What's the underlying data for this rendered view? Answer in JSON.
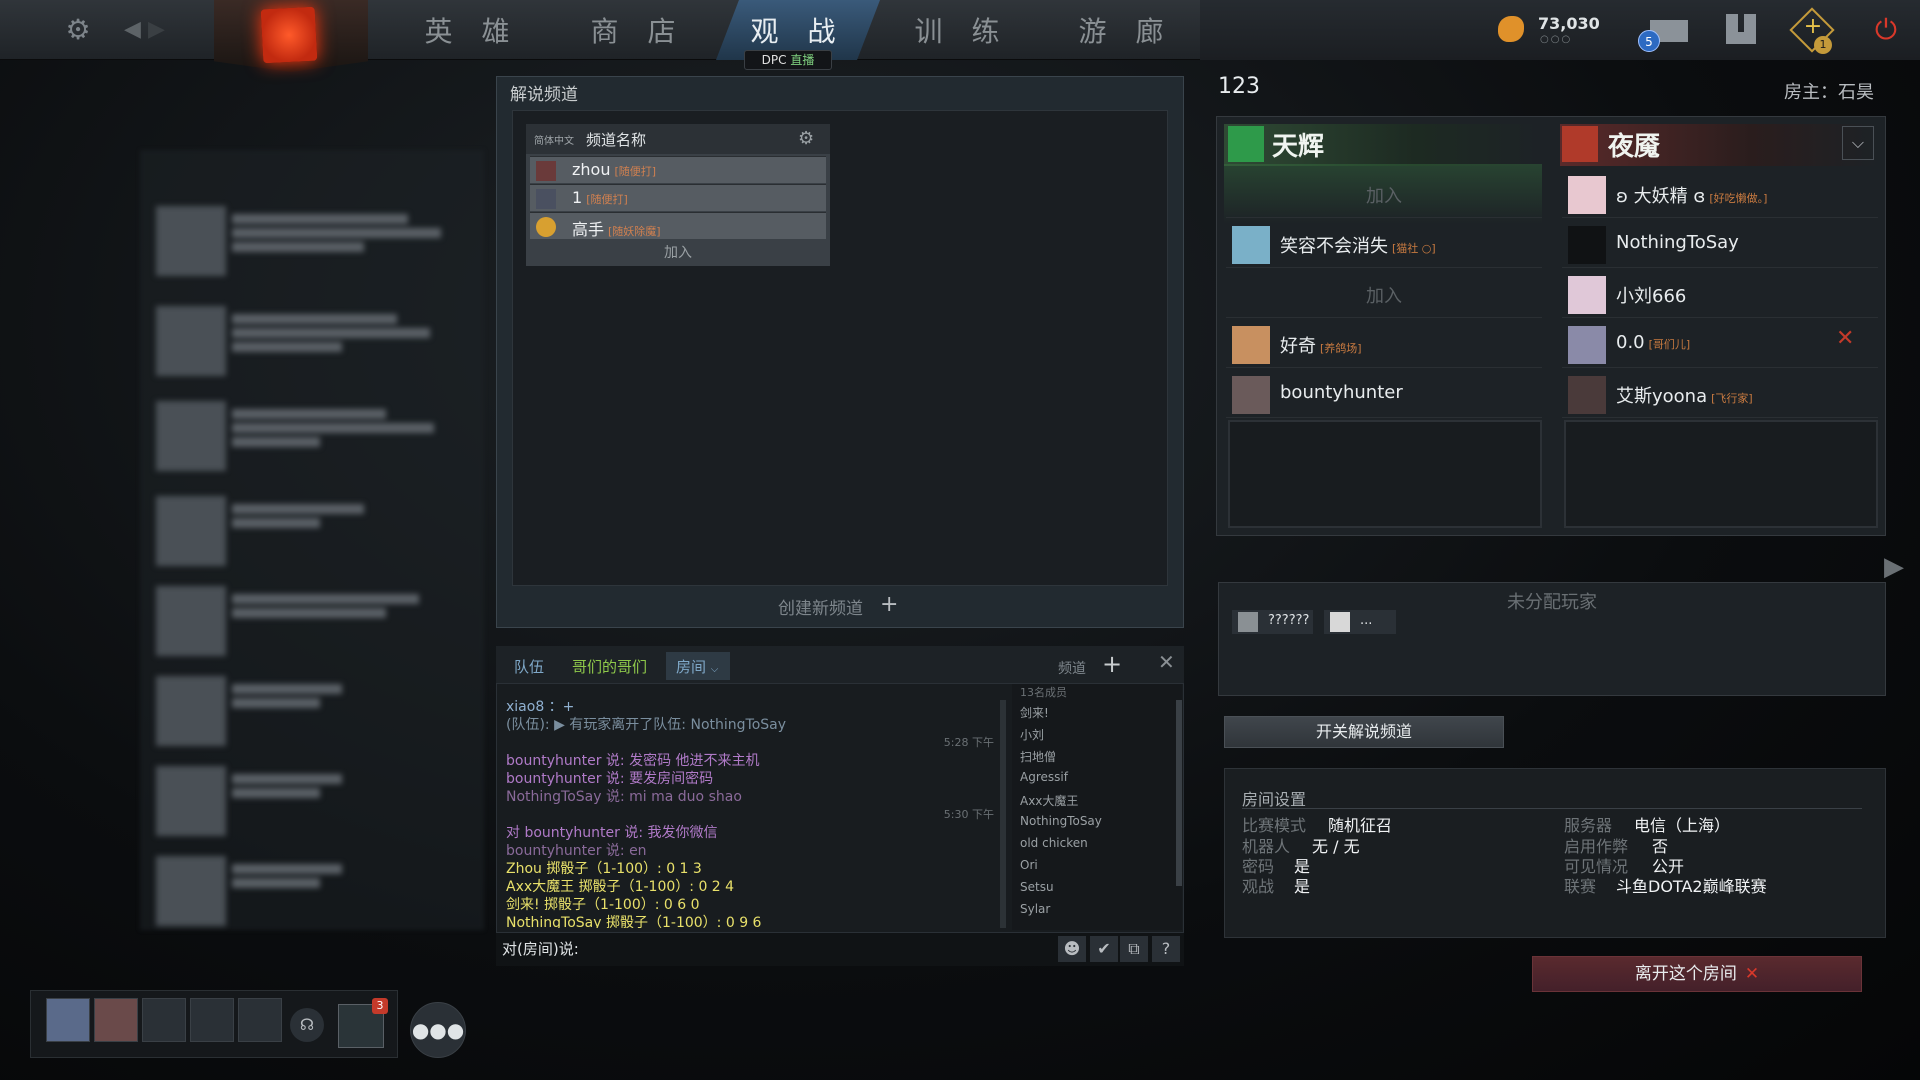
{
  "nav": {
    "tabs": [
      "英 雄",
      "商 店",
      "观 战",
      "训 练",
      "游 廊"
    ],
    "dpc_badge": "DPC",
    "dpc_live": "直播",
    "shards": "73,030",
    "shards_dots": "○○○",
    "mail_count": "5",
    "plus_count": "1"
  },
  "channel_panel": {
    "title": "解说频道",
    "lang": "简体中文",
    "name_header": "频道名称",
    "rows": [
      {
        "name": "zhou",
        "tag": "[随便打]"
      },
      {
        "name": "1",
        "tag": "[随便打]"
      },
      {
        "name": "高手",
        "tag": "[随妖除魔]"
      }
    ],
    "join": "加入",
    "create": "创建新频道"
  },
  "chat": {
    "tabs": {
      "team": "队伍",
      "bros": "哥们的哥们",
      "room": "房间",
      "channel": "频道"
    },
    "messages": [
      {
        "text": "xiao8 ：+",
        "color": "#8fb0d0"
      },
      {
        "text": "(队伍): ▶ 有玩家离开了队伍: NothingToSay",
        "color": "#7a8e9e"
      },
      {
        "text": "bountyhunter 说: 发密码 他进不来主机",
        "color": "#b07ac8"
      },
      {
        "text": "bountyhunter 说: 要发房间密码",
        "color": "#b07ac8"
      },
      {
        "text": "NothingToSay 说: mi ma duo shao",
        "color": "#8a6a9a"
      },
      {
        "text": "对 bountyhunter 说: 我发你微信",
        "color": "#b07ac8"
      },
      {
        "text": "bountyhunter 说: en",
        "color": "#8a6a9a"
      },
      {
        "text": "Zhou 掷骰子（1-100）: 0 1 3",
        "color": "#e8e06a"
      },
      {
        "text": "Axx大魔王 掷骰子（1-100）: 0 2 4",
        "color": "#e8e06a"
      },
      {
        "text": "剑来! 掷骰子（1-100）: 0 6 0",
        "color": "#e8e06a"
      },
      {
        "text": "NothingToSay 掷骰子（1-100）: 0 9 6",
        "color": "#e8e06a"
      }
    ],
    "time1": "5:28 下午",
    "time2": "5:30 下午",
    "member_count": "13名成员",
    "members": [
      "剑来!",
      "小刘",
      "扫地僧",
      "Agressif",
      "Axx大魔王",
      "NothingToSay",
      "old chicken",
      "Ori",
      "Setsu",
      "Sylar"
    ],
    "input_prefix": "对(房间)说:"
  },
  "lobby": {
    "name": "123",
    "host": "房主：石昊",
    "radiant": "天辉",
    "dire": "夜魇",
    "join": "加入",
    "radiant_slots": [
      {
        "type": "join"
      },
      {
        "type": "player",
        "name": "笑容不会消失",
        "tag": "[猫社 ○]"
      },
      {
        "type": "join"
      },
      {
        "type": "player",
        "name": "好奇",
        "tag": "[养鸽场]"
      },
      {
        "type": "player",
        "name": "bountyhunter",
        "tag": ""
      }
    ],
    "dire_slots": [
      {
        "name": "ʚ 大妖精 ɞ",
        "tag": "[好吃懒做。]"
      },
      {
        "name": "NothingToSay",
        "tag": ""
      },
      {
        "name": "小刘666",
        "tag": ""
      },
      {
        "name": "0.0",
        "tag": "[哥们儿]"
      },
      {
        "name": "艾斯yoona",
        "tag": "[飞行家]"
      }
    ],
    "unassigned_title": "未分配玩家",
    "unassigned": [
      "??????",
      "..."
    ],
    "toggle_channel": "开关解说频道",
    "settings_title": "房间设置",
    "settings_left": [
      {
        "k": "比赛模式",
        "v": "随机征召"
      },
      {
        "k": "机器人",
        "v": "无 / 无"
      },
      {
        "k": "密码",
        "v": "是"
      },
      {
        "k": "观战",
        "v": "是"
      }
    ],
    "settings_right": [
      {
        "k": "服务器",
        "v": "电信（上海）"
      },
      {
        "k": "启用作弊",
        "v": "否"
      },
      {
        "k": "可见情况",
        "v": "公开"
      },
      {
        "k": "联赛",
        "v": "斗鱼DOTA2巅峰联赛"
      }
    ],
    "leave": "离开这个房间"
  },
  "party": {
    "guild_count": "3"
  }
}
